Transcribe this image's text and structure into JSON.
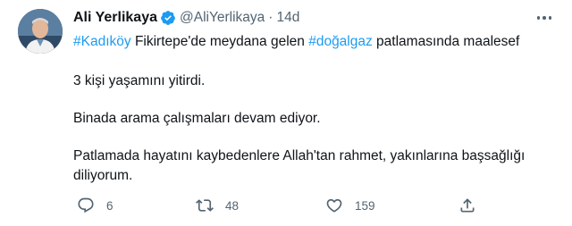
{
  "tweet": {
    "author": {
      "name": "Ali Yerlikaya",
      "handle": "@AliYerlikaya",
      "verified": true,
      "avatar_icon": "profile-photo"
    },
    "separator": "·",
    "time": "14d",
    "text": {
      "line1": {
        "tag1": "#Kadıköy",
        "part1": " Fikirtepe'de meydana gelen ",
        "tag2": "#doğalgaz",
        "part2": " patlamasında maalesef"
      },
      "line2": "3 kişi yaşamını yitirdi.",
      "line3": "Binada arama çalışmaları devam ediyor.",
      "line4": "Patlamada hayatını kaybedenlere Allah'tan rahmet, yakınlarına başsağlığı diliyorum."
    },
    "actions": {
      "reply": {
        "icon": "reply-icon",
        "count": "6"
      },
      "retweet": {
        "icon": "retweet-icon",
        "count": "48"
      },
      "like": {
        "icon": "heart-icon",
        "count": "159"
      },
      "share": {
        "icon": "share-icon"
      }
    },
    "more_icon": "more-dots-icon"
  },
  "colors": {
    "accent": "#1d9bf0",
    "text": "#0f1419",
    "secondary": "#536471"
  }
}
